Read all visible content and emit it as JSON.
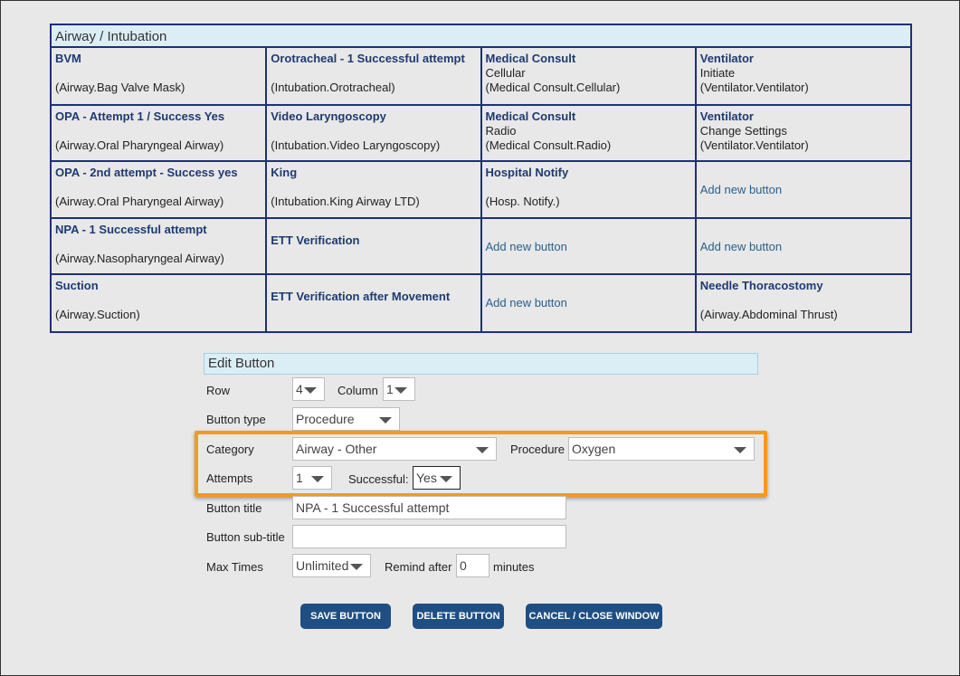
{
  "grid": {
    "title": "Airway / Intubation",
    "rows": [
      [
        {
          "title": "BVM",
          "sub": "",
          "code": "(Airway.Bag Valve Mask)"
        },
        {
          "title": "Orotracheal - 1 Successful attempt",
          "sub": "",
          "code": "(Intubation.Orotracheal)"
        },
        {
          "title": "Medical Consult",
          "sub": "Cellular",
          "code": "(Medical Consult.Cellular)"
        },
        {
          "title": "Ventilator",
          "sub": "Initiate",
          "code": "(Ventilator.Ventilator)"
        }
      ],
      [
        {
          "title": "OPA - Attempt 1 / Success Yes",
          "sub": "",
          "code": "(Airway.Oral Pharyngeal Airway)"
        },
        {
          "title": "Video Laryngoscopy",
          "sub": "",
          "code": "(Intubation.Video Laryngoscopy)"
        },
        {
          "title": "Medical Consult",
          "sub": "Radio",
          "code": "(Medical Consult.Radio)"
        },
        {
          "title": "Ventilator",
          "sub": "Change Settings",
          "code": "(Ventilator.Ventilator)"
        }
      ],
      [
        {
          "title": "OPA - 2nd attempt - Success yes",
          "sub": "",
          "code": "(Airway.Oral Pharyngeal Airway)"
        },
        {
          "title": "King",
          "sub": "",
          "code": "(Intubation.King Airway LTD)"
        },
        {
          "title": "Hospital Notify",
          "sub": "",
          "code": "(Hosp. Notify.)"
        },
        {
          "add": "Add new button"
        }
      ],
      [
        {
          "title": "NPA - 1 Successful attempt",
          "sub": "",
          "code": "(Airway.Nasopharyngeal Airway)"
        },
        {
          "title": "ETT Verification",
          "mid": true
        },
        {
          "add": "Add new button"
        },
        {
          "add": "Add new button"
        }
      ],
      [
        {
          "title": "Suction",
          "sub": "",
          "code": "(Airway.Suction)"
        },
        {
          "title": "ETT Verification after Movement",
          "mid": true
        },
        {
          "add": "Add new button"
        },
        {
          "title": "Needle Thoracostomy",
          "sub": "",
          "code": "(Airway.Abdominal Thrust)"
        }
      ]
    ]
  },
  "edit": {
    "title": "Edit Button",
    "row_label": "Row",
    "row_value": "4",
    "column_label": "Column",
    "column_value": "1",
    "type_label": "Button type",
    "type_value": "Procedure",
    "category_label": "Category",
    "category_value": "Airway - Other",
    "procedure_label": "Procedure",
    "procedure_value": "Oxygen",
    "attempts_label": "Attempts",
    "attempts_value": "1",
    "successful_label": "Successful:",
    "successful_value": "Yes",
    "btitle_label": "Button title",
    "btitle_value": "NPA - 1 Successful attempt",
    "bsub_label": "Button sub-title",
    "bsub_value": "",
    "max_label": "Max Times",
    "max_value": "Unlimited",
    "remind_label": "Remind after",
    "remind_value": "0",
    "minutes_label": "minutes"
  },
  "actions": {
    "save": "SAVE BUTTON",
    "delete": "DELETE BUTTON",
    "cancel": "CANCEL / CLOSE WINDOW"
  },
  "colors": {
    "accent": "#1f4f82",
    "highlight": "#f59a1b",
    "grid_border": "#1f2f7a",
    "header_bg": "#dbeef6"
  }
}
